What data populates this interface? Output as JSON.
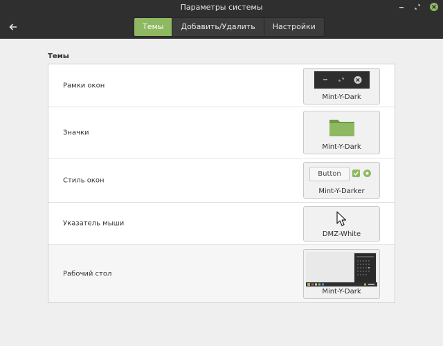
{
  "window": {
    "title": "Параметры системы"
  },
  "tabs": [
    {
      "label": "Темы",
      "active": true
    },
    {
      "label": "Добавить/Удалить",
      "active": false
    },
    {
      "label": "Настройки",
      "active": false
    }
  ],
  "section": {
    "title": "Темы"
  },
  "rows": [
    {
      "label": "Рамки окон",
      "theme": "Mint-Y-Dark",
      "preview_icon": "window-controls-icon"
    },
    {
      "label": "Значки",
      "theme": "Mint-Y-Dark",
      "preview_icon": "folder-icon"
    },
    {
      "label": "Стиль окон",
      "theme": "Mint-Y-Darker",
      "preview_icon": "widget-preview",
      "button_label": "Button"
    },
    {
      "label": "Указатель мыши",
      "theme": "DMZ-White",
      "preview_icon": "cursor-icon"
    },
    {
      "label": "Рабочий стол",
      "theme": "Mint-Y-Dark",
      "preview_icon": "desktop-preview"
    }
  ],
  "colors": {
    "accent": "#8fb862",
    "titlebar": "#2f2f2f",
    "background": "#efefef"
  }
}
